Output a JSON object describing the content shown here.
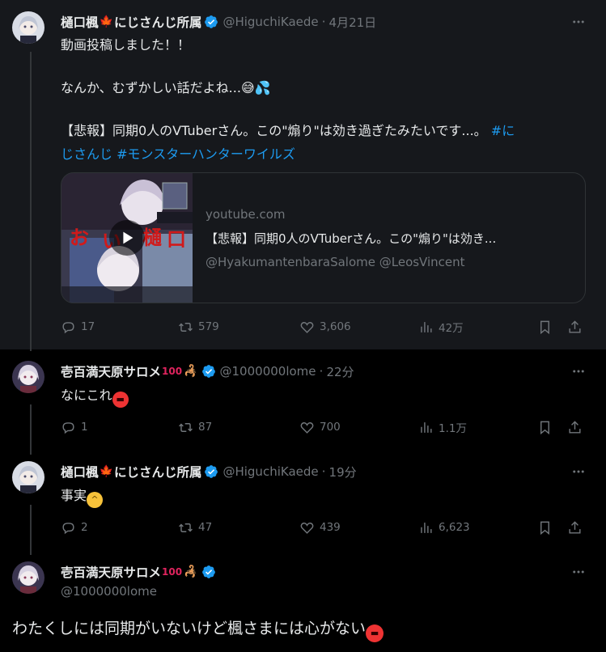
{
  "tweets": [
    {
      "name": "樋口楓🍁にじさんじ所属",
      "name_prefix": "樋口楓",
      "name_suffix": "にじさんじ所属",
      "handle": "@HiguchiKaede",
      "time": "4月21日",
      "line1": "動画投稿しました！！",
      "line2": "なんか、むずかしい話だよね...😅💦",
      "line3_text": "【悲報】同期0人のVTuberさん。この\"煽り\"は効き過ぎたみたいです...。",
      "line3_hashtag1": "#に",
      "line4_hashtag1_cont": "じさんじ",
      "line4_hashtag2": "#モンスターハンターワイルズ",
      "card": {
        "domain": "youtube.com",
        "title": "【悲報】同期0人のVTuberさん。この\"煽り\"は効き...",
        "sub": "@HyakumantenbaraSalome @LeosVincent"
      },
      "replies": "17",
      "retweets": "579",
      "likes": "3,606",
      "views": "42万"
    },
    {
      "name": "壱百満天原サロメ💯🦂",
      "name_text": "壱百満天原サロメ",
      "handle": "@1000000lome",
      "time": "22分",
      "text": "なにこれ😡",
      "text_main": "なにこれ",
      "replies": "1",
      "retweets": "87",
      "likes": "700",
      "views": "1.1万"
    },
    {
      "name": "樋口楓🍁にじさんじ所属",
      "name_prefix": "樋口楓",
      "name_suffix": "にじさんじ所属",
      "handle": "@HiguchiKaede",
      "time": "19分",
      "text": "事実😅",
      "text_main": "事実",
      "replies": "2",
      "retweets": "47",
      "likes": "439",
      "views": "6,623"
    },
    {
      "name": "壱百満天原サロメ💯🦂",
      "name_text": "壱百満天原サロメ",
      "handle": "@1000000lome",
      "text": "わたくしには同期がいないけど楓さまには心がない😡",
      "text_main": "わたくしには同期がいないけど楓さまには心がない"
    }
  ],
  "icons": [
    "verified-badge-icon",
    "more-icon",
    "reply-icon",
    "retweet-icon",
    "like-icon",
    "views-icon",
    "bookmark-icon",
    "share-icon",
    "play-icon"
  ],
  "colors": {
    "accent": "#1d9bf0",
    "muted": "#71767b",
    "text": "#e7e9ea",
    "bg": "#000000",
    "highlight_bg": "#16181c"
  }
}
